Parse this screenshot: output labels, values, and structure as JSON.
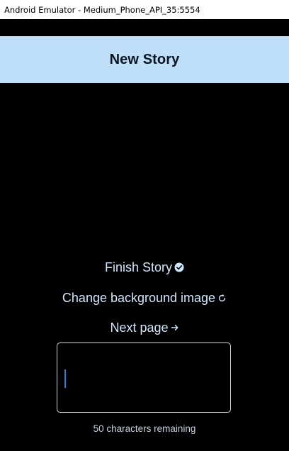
{
  "window": {
    "title": "Android Emulator - Medium_Phone_API_35:5554"
  },
  "app_bar": {
    "title": "New Story"
  },
  "actions": {
    "finish_story": {
      "label": "Finish Story",
      "icon": "check-circle-icon"
    },
    "change_background": {
      "label": "Change background image",
      "icon": "refresh-icon"
    },
    "next_page": {
      "label": "Next page",
      "icon": "arrow-right-icon"
    }
  },
  "story_input": {
    "value": "",
    "counter_text": "50 characters remaining"
  },
  "colors": {
    "app_bar_bg": "#bfdff9",
    "action_text": "#cfe6fb",
    "caret": "#2f7fd1",
    "screen_bg": "#000000"
  }
}
